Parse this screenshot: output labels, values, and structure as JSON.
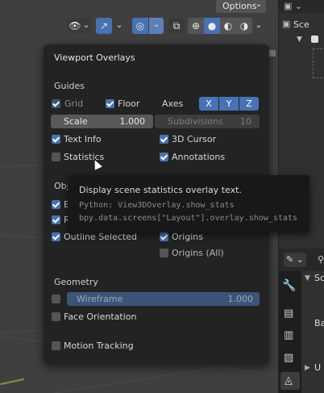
{
  "header": {
    "options_label": "Options",
    "icons": [
      "eye-icon",
      "gizmo-icon",
      "overlays-icon",
      "xray-icon",
      "wireframe-shading-icon",
      "solid-shading-icon",
      "material-shading-icon",
      "rendered-shading-icon"
    ]
  },
  "right_panel": {
    "scene_label": "Sce",
    "props_label": "Sc",
    "ba_label": "Ba",
    "u_label": "U"
  },
  "popup": {
    "title": "Viewport Overlays",
    "guides": {
      "heading": "Guides",
      "grid": {
        "label": "Grid",
        "checked": true,
        "enabled": false
      },
      "floor": {
        "label": "Floor",
        "checked": true
      },
      "axes_label": "Axes",
      "axes": [
        "X",
        "Y",
        "Z"
      ],
      "scale": {
        "label": "Scale",
        "value": "1.000"
      },
      "subdivisions": {
        "label": "Subdivisions",
        "value": "10"
      },
      "text_info": {
        "label": "Text Info",
        "checked": true
      },
      "cursor": {
        "label": "3D Cursor",
        "checked": true
      },
      "statistics": {
        "label": "Statistics",
        "checked": false
      },
      "annotations": {
        "label": "Annotations",
        "checked": true
      }
    },
    "objects": {
      "heading": "Obj",
      "row1_label": "E",
      "row2_label": "R",
      "outline_selected": {
        "label": "Outline Selected",
        "checked": true
      },
      "origins": {
        "label": "Origins",
        "checked": true
      },
      "origins_all": {
        "label": "Origins (All)",
        "checked": false
      }
    },
    "geometry": {
      "heading": "Geometry",
      "wireframe": {
        "label": "Wireframe",
        "value": "1.000",
        "checked": false
      },
      "face_orientation": {
        "label": "Face Orientation",
        "checked": false
      },
      "motion_tracking": {
        "label": "Motion Tracking",
        "checked": false
      }
    }
  },
  "tooltip": {
    "description": "Display scene statistics overlay text.",
    "python": "Python: View3DOverlay.show_stats",
    "path": "bpy.data.screens[\"Layout\"].overlay.show_stats"
  }
}
